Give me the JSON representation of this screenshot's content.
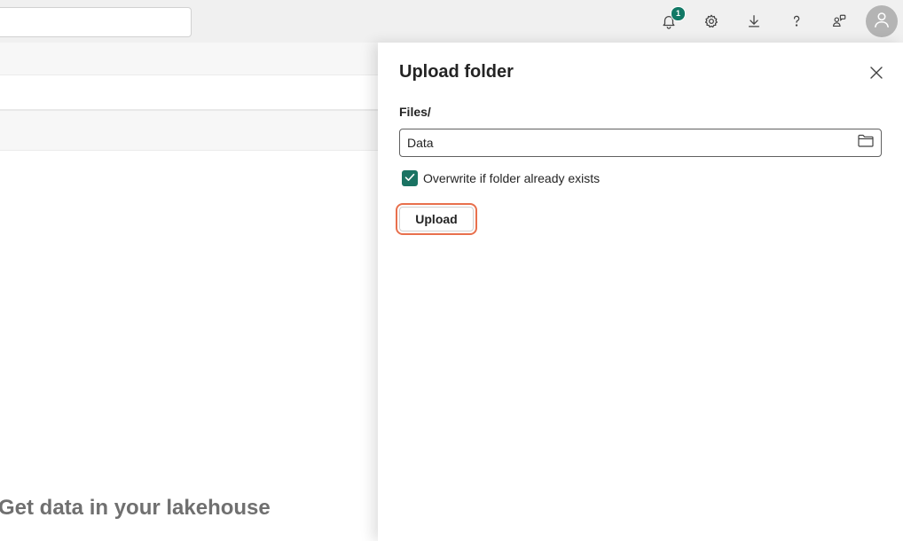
{
  "topbar": {
    "search": {
      "value": "",
      "placeholder": ""
    },
    "icons": [
      "bell-icon",
      "gear-icon",
      "download-icon",
      "help-icon",
      "share-icon",
      "avatar"
    ],
    "notifications": {
      "count": "1"
    }
  },
  "background": {
    "heading": "Get data in your lakehouse"
  },
  "panel": {
    "title": "Upload folder",
    "path_label": "Files/",
    "folder_input": {
      "value": "Data",
      "placeholder": ""
    },
    "overwrite": {
      "label": "Overwrite if folder already exists",
      "checked": true
    },
    "upload_label": "Upload"
  },
  "colors": {
    "accent": "#117865",
    "checkbox": "#1a7363",
    "highlight": "#e8704d",
    "topbar_bg": "#f0f0f0"
  }
}
